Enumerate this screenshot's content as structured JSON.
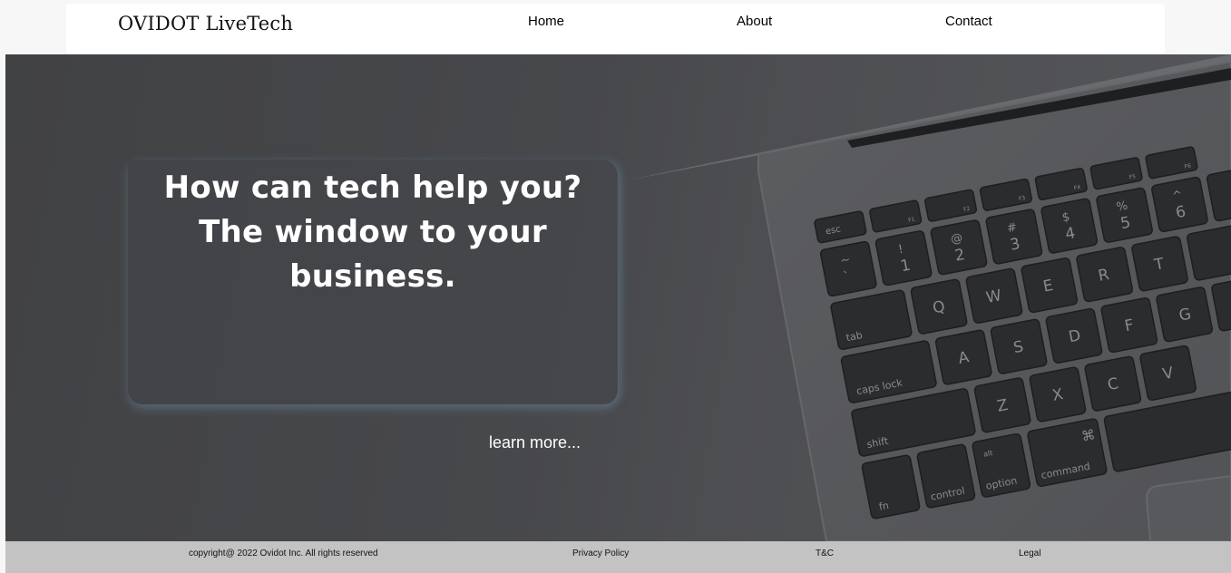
{
  "header": {
    "brand": "OVIDOT LiveTech",
    "nav": {
      "home": "Home",
      "about": "About",
      "contact": "Contact"
    }
  },
  "hero": {
    "headline_line1": "How can tech help you?",
    "headline_line2": "The window to your business.",
    "cta": "learn more...",
    "image_icon": "laptop-keyboard",
    "keys": {
      "esc": "esc",
      "tab": "tab",
      "caps": "caps lock",
      "shift": "shift",
      "fn": "fn",
      "control": "control",
      "option": "option",
      "alt": "alt",
      "command": "command",
      "cmd_symbol": "⌘",
      "f1": "F1",
      "f2": "F2",
      "f3": "F3",
      "f4": "F4",
      "f5": "F5",
      "f6": "F6",
      "tilde": "~",
      "backtick": "`",
      "n1_top": "!",
      "n1": "1",
      "n2_top": "@",
      "n2": "2",
      "n3_top": "#",
      "n3": "3",
      "n4_top": "$",
      "n4": "4",
      "n5_top": "%",
      "n5": "5",
      "n6_top": "^",
      "n6": "6",
      "q": "Q",
      "w": "W",
      "e": "E",
      "r": "R",
      "t": "T",
      "a": "A",
      "s": "S",
      "d": "D",
      "f": "F",
      "g": "G",
      "z": "Z",
      "x": "X",
      "c": "C",
      "v": "V"
    }
  },
  "footer": {
    "copyright": "copyright@ 2022 Ovidot Inc. All rights reserved",
    "privacy": "Privacy Policy",
    "terms": "T&C",
    "legal": "Legal"
  },
  "colors": {
    "hero_bg": "#46474a",
    "footer_bg": "#c4c3c3",
    "header_bg": "#ffffff",
    "text_light": "#ffffff"
  }
}
